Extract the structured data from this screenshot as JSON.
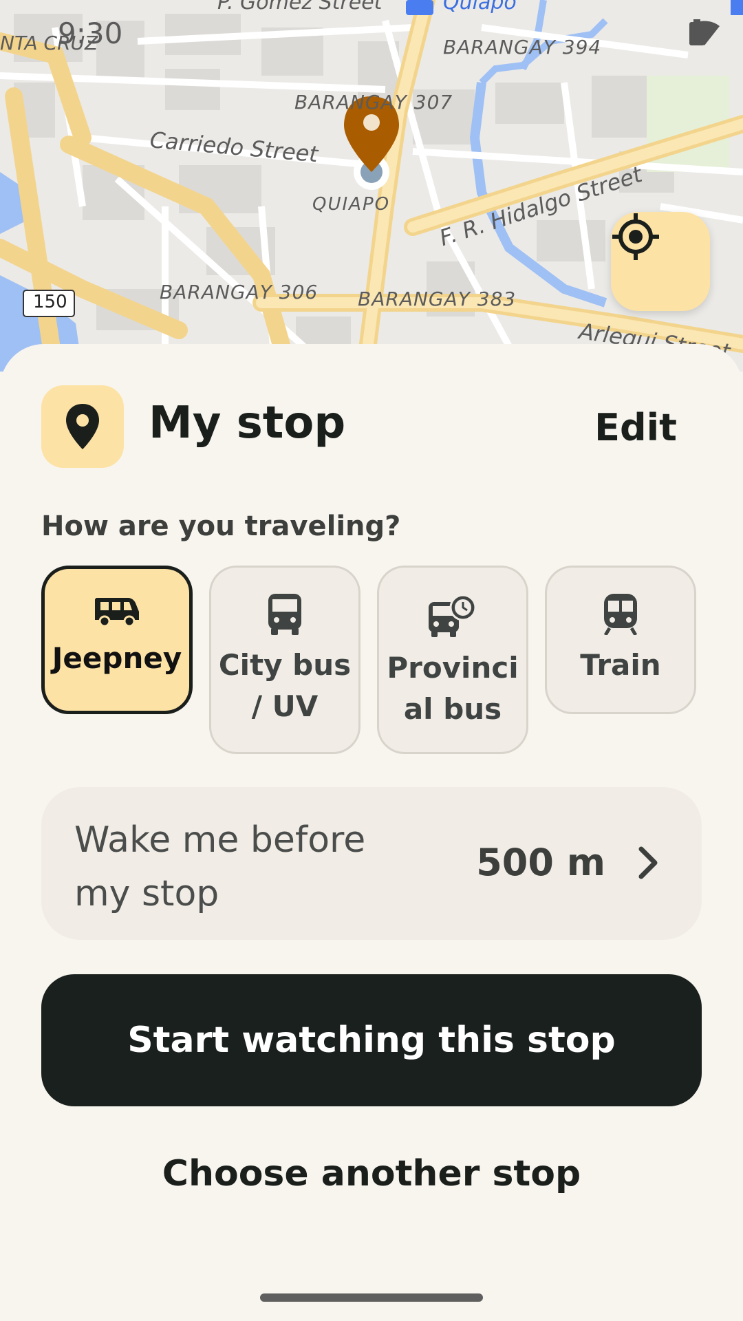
{
  "status_bar": {
    "time": "9:30"
  },
  "map": {
    "labels": {
      "gomez": "P. Gomez Street",
      "quiapo_top": "Quiapo",
      "santa_cruz": "NTA CRUZ",
      "brgy394": "BARANGAY 394",
      "brgy307": "BARANGAY 307",
      "carriedo": "Carriedo Street",
      "quiapo": "QUIAPO",
      "hidalgo": "F. R. Hidalgo Street",
      "brgy306": "BARANGAY 306",
      "brgy383": "BARANGAY 383",
      "arlegui": "Arlegui Street",
      "road_shield": "150"
    },
    "pin_color": "#a95c00",
    "icons": {
      "pin": "map-pin-icon",
      "locate": "my-location-icon",
      "bus_stop": "bus-stop-icon"
    }
  },
  "sheet": {
    "title": "My stop",
    "edit_label": "Edit",
    "question": "How are you traveling?",
    "modes": [
      {
        "label": "Jeepney",
        "icon": "jeepney-icon",
        "selected": true
      },
      {
        "label": "City bus / UV",
        "icon": "bus-icon",
        "selected": false
      },
      {
        "label": "Provincial bus",
        "icon": "scheduled-bus-icon",
        "selected": false
      },
      {
        "label": "Train",
        "icon": "train-icon",
        "selected": false
      }
    ],
    "wake": {
      "label": "Wake me before my stop",
      "value": "500 m"
    },
    "start_label": "Start watching this stop",
    "other_label": "Choose another stop"
  },
  "colors": {
    "accent": "#fde2a6",
    "dark": "#1a201d",
    "background": "#f8f5ef"
  }
}
